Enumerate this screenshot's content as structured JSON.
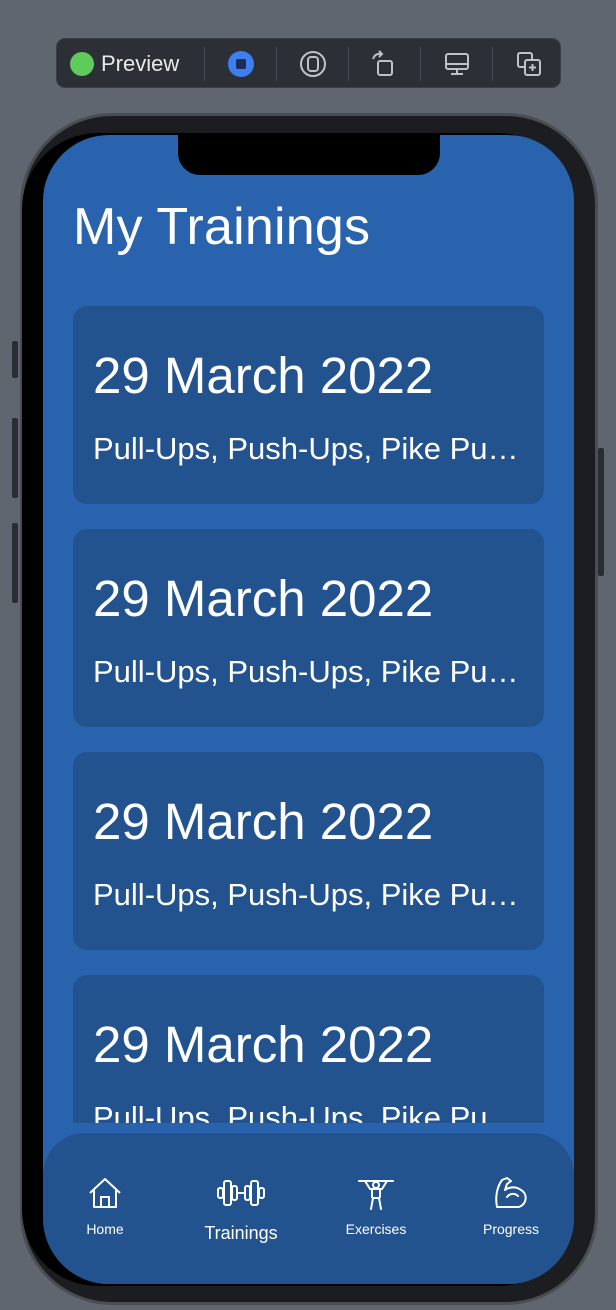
{
  "toolbar": {
    "label": "Preview",
    "status_color": "#5ecb5a",
    "icons": [
      "live-stop-icon",
      "variant-icon",
      "rotate-icon",
      "device-settings-icon",
      "duplicate-icon"
    ]
  },
  "screen": {
    "title": "My Trainings",
    "background": "#2963ae",
    "card_color": "#23538f",
    "trainings": [
      {
        "date": "29 March 2022",
        "exercises": "Pull-Ups, Push-Ups, Pike Push-Ups"
      },
      {
        "date": "29 March 2022",
        "exercises": "Pull-Ups, Push-Ups, Pike Push-Ups"
      },
      {
        "date": "29 March 2022",
        "exercises": "Pull-Ups, Push-Ups, Pike Push-Ups"
      },
      {
        "date": "29 March 2022",
        "exercises": "Pull-Ups, Push-Ups, Pike Push-Ups"
      }
    ]
  },
  "tabbar": {
    "tabs": [
      {
        "label": "Home",
        "icon": "home-icon"
      },
      {
        "label": "Trainings",
        "icon": "dumbbell-icon",
        "selected": true
      },
      {
        "label": "Exercises",
        "icon": "exercise-figure-icon"
      },
      {
        "label": "Progress",
        "icon": "bicep-icon"
      }
    ]
  }
}
